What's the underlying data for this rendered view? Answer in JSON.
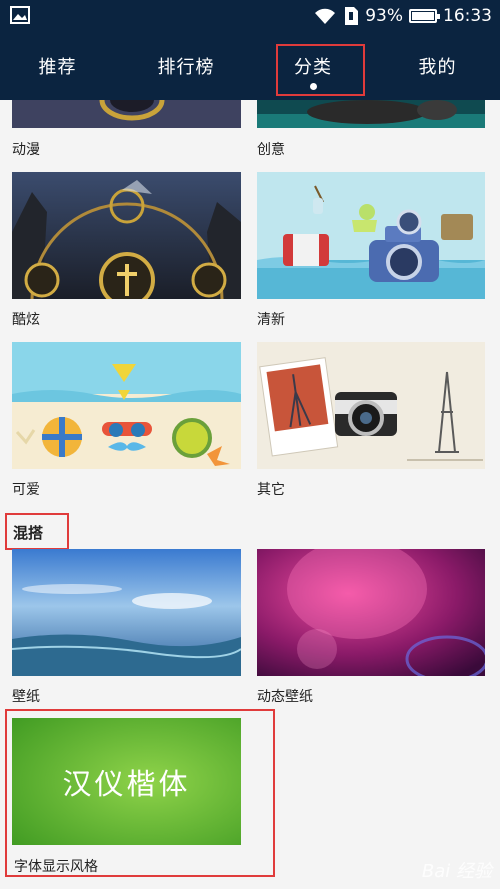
{
  "status_bar": {
    "battery_percent": "93%",
    "battery_level": 0.93,
    "time": "16:33",
    "icons": [
      "image-icon",
      "wifi-icon",
      "sim-icon",
      "battery-icon"
    ]
  },
  "nav": {
    "tabs": [
      {
        "label": "推荐"
      },
      {
        "label": "排行榜"
      },
      {
        "label": "分类",
        "active": true
      },
      {
        "label": "我的"
      }
    ]
  },
  "categories": [
    {
      "label": "动漫"
    },
    {
      "label": "创意"
    },
    {
      "label": "酷炫"
    },
    {
      "label": "清新"
    },
    {
      "label": "可爱"
    },
    {
      "label": "其它"
    }
  ],
  "mix_section": {
    "title": "混搭",
    "items": [
      {
        "label": "壁纸"
      },
      {
        "label": "动态壁纸"
      },
      {
        "label": "字体显示风格",
        "image_text": "汉仪楷体"
      }
    ]
  },
  "watermark": "Bai 经验",
  "colors": {
    "nav_bg": "#0b2440",
    "highlight": "#e03b3b",
    "page_bg": "#f4f4f4"
  }
}
